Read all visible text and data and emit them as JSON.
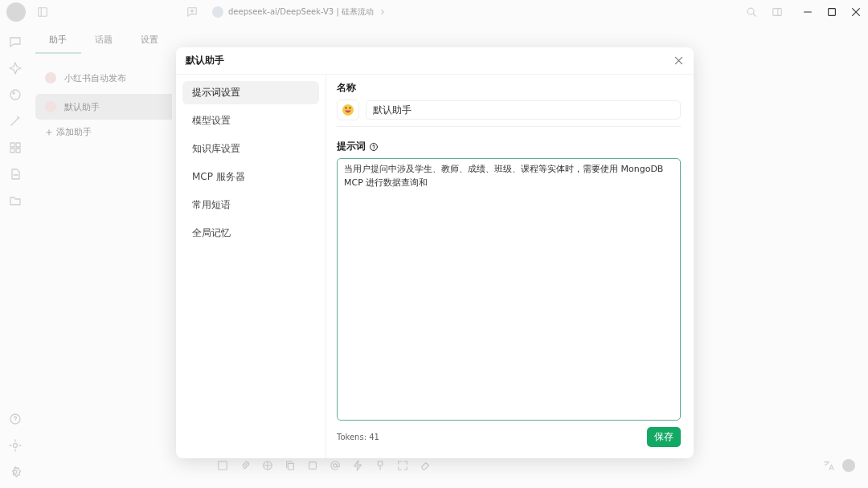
{
  "titlebar": {
    "model": "deepseek-ai/DeepSeek-V3 | 硅基流动"
  },
  "sidebar_tabs": [
    {
      "label": "助手",
      "selected": true
    },
    {
      "label": "话题",
      "selected": false
    },
    {
      "label": "设置",
      "selected": false
    }
  ],
  "assistants": [
    {
      "name": "小红书自动发布",
      "selected": false
    },
    {
      "name": "默认助手",
      "selected": true
    }
  ],
  "add_assistant": "添加助手",
  "dialog": {
    "title": "默认助手",
    "nav": [
      {
        "label": "提示词设置",
        "selected": true
      },
      {
        "label": "模型设置",
        "selected": false
      },
      {
        "label": "知识库设置",
        "selected": false
      },
      {
        "label": "MCP 服务器",
        "selected": false
      },
      {
        "label": "常用短语",
        "selected": false
      },
      {
        "label": "全局记忆",
        "selected": false
      }
    ],
    "name_label": "名称",
    "name_value": "默认助手",
    "prompt_label": "提示词",
    "prompt_value": "当用户提问中涉及学生、教师、成绩、班级、课程等实体时，需要使用 MongoDB MCP 进行数据查询和",
    "tokens": "Tokens: 41",
    "save": "保存"
  }
}
